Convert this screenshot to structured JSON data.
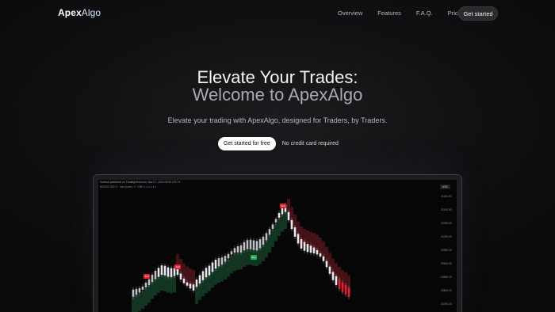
{
  "nav": {
    "logo_bold": "Apex",
    "logo_light": "Algo",
    "links": [
      "Overview",
      "Features",
      "F.A.Q.",
      "Pricing"
    ],
    "cta": "Get started"
  },
  "hero": {
    "title_line1": "Elevate Your Trades:",
    "title_line2": "Welcome to ApexAlgo",
    "subtitle": "Elevate your trading with ApexAlgo, designed for Traders, by Traders.",
    "cta_button": "Get started for free",
    "cta_note": "No credit card required"
  },
  "chart_preview": {
    "published": "Surface published on TradingView.com, Nov 27, 2024 09:00 UTC-5",
    "legend": "NAS100 USD 3 · hard punns, 4 · CME",
    "currency": "USD",
    "price_labels": [
      "21150.00",
      "21100.00",
      "21050.00",
      "21000.00",
      "20950.00",
      "20900.00",
      "20850.00",
      "20800.00",
      "20750.00"
    ],
    "signals": [
      "Sell",
      "Sell",
      "Buy",
      "Sell"
    ],
    "colors": {
      "up": "#e8e8ec",
      "down": "#c0c0c8",
      "bull_band": "#1c5c34",
      "bear_band": "#7a1f24",
      "sell": "#e0232e",
      "buy": "#21a84e"
    }
  }
}
